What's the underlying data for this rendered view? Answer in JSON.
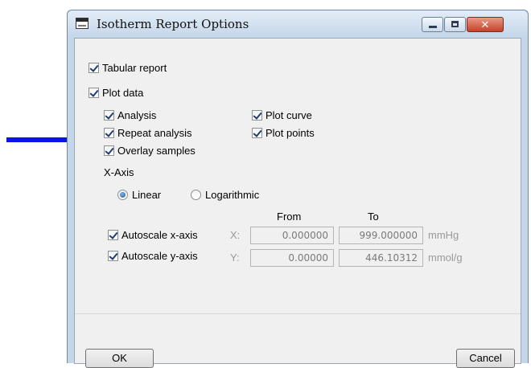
{
  "window": {
    "title": "Isotherm Report Options"
  },
  "options": {
    "tabular_report": "Tabular report",
    "plot_data": "Plot data",
    "analysis": "Analysis",
    "repeat_analysis": "Repeat analysis",
    "overlay_samples": "Overlay samples",
    "plot_curve": "Plot curve",
    "plot_points": "Plot points"
  },
  "xaxis": {
    "heading": "X-Axis",
    "linear": "Linear",
    "logarithmic": "Logarithmic",
    "selected": "Linear"
  },
  "scale": {
    "from_header": "From",
    "to_header": "To",
    "x": {
      "label": "Autoscale x-axis",
      "axis": "X:",
      "from": "0.000000",
      "to": "999.000000",
      "unit": "mmHg"
    },
    "y": {
      "label": "Autoscale y-axis",
      "axis": "Y:",
      "from": "0.00000",
      "to": "446.10312",
      "unit": "mmol/g"
    }
  },
  "buttons": {
    "ok": "OK",
    "cancel": "Cancel"
  },
  "colors": {
    "arrow": "#0a16e6",
    "title_bar": "#c4d6ea",
    "close": "#c7412a"
  }
}
